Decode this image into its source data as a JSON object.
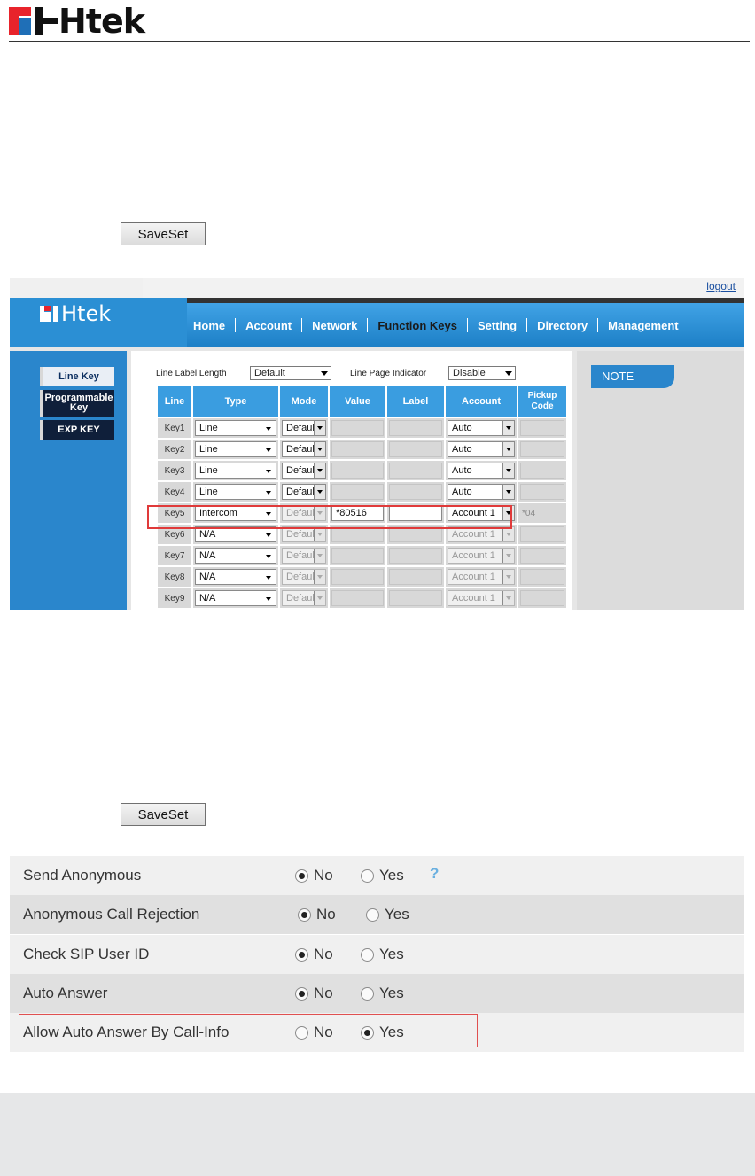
{
  "document": {
    "brand": "Htek"
  },
  "buttons": {
    "saveset_1": "SaveSet",
    "saveset_2": "SaveSet"
  },
  "webui": {
    "logout": "logout",
    "brand": "Htek",
    "nav": [
      {
        "label": "Home",
        "active": false
      },
      {
        "label": "Account",
        "active": false
      },
      {
        "label": "Network",
        "active": false
      },
      {
        "label": "Function Keys",
        "active": true
      },
      {
        "label": "Setting",
        "active": false
      },
      {
        "label": "Directory",
        "active": false
      },
      {
        "label": "Management",
        "active": false
      }
    ],
    "sidebar": [
      {
        "label": "Line Key",
        "active": true
      },
      {
        "label": "Programmable Key",
        "active": false
      },
      {
        "label": "EXP KEY",
        "active": false
      }
    ],
    "note_title": "NOTE",
    "line_label_length": {
      "label": "Line Label Length",
      "value": "Default"
    },
    "line_page_indicator": {
      "label": "Line Page Indicator",
      "value": "Disable"
    },
    "columns": [
      "Line",
      "Type",
      "Mode",
      "Value",
      "Label",
      "Account",
      "Pickup Code"
    ],
    "rows": [
      {
        "key": "Key1",
        "type": "Line",
        "mode": "Default",
        "value": "",
        "label": "",
        "account": "Auto",
        "pickup": "",
        "enabled": true,
        "editable": false
      },
      {
        "key": "Key2",
        "type": "Line",
        "mode": "Default",
        "value": "",
        "label": "",
        "account": "Auto",
        "pickup": "",
        "enabled": true,
        "editable": false
      },
      {
        "key": "Key3",
        "type": "Line",
        "mode": "Default",
        "value": "",
        "label": "",
        "account": "Auto",
        "pickup": "",
        "enabled": true,
        "editable": false
      },
      {
        "key": "Key4",
        "type": "Line",
        "mode": "Default",
        "value": "",
        "label": "",
        "account": "Auto",
        "pickup": "",
        "enabled": true,
        "editable": false
      },
      {
        "key": "Key5",
        "type": "Intercom",
        "mode": "Default",
        "value": "*80516",
        "label": "",
        "account": "Account 1",
        "pickup": "*04",
        "enabled": false,
        "editable": true
      },
      {
        "key": "Key6",
        "type": "N/A",
        "mode": "Default",
        "value": "",
        "label": "",
        "account": "Account 1",
        "pickup": "",
        "enabled": false,
        "editable": false
      },
      {
        "key": "Key7",
        "type": "N/A",
        "mode": "Default",
        "value": "",
        "label": "",
        "account": "Account 1",
        "pickup": "",
        "enabled": false,
        "editable": false
      },
      {
        "key": "Key8",
        "type": "N/A",
        "mode": "Default",
        "value": "",
        "label": "",
        "account": "Account 1",
        "pickup": "",
        "enabled": false,
        "editable": false
      },
      {
        "key": "Key9",
        "type": "N/A",
        "mode": "Default",
        "value": "",
        "label": "",
        "account": "Account 1",
        "pickup": "",
        "enabled": false,
        "editable": false
      }
    ]
  },
  "settings": {
    "no_label": "No",
    "yes_label": "Yes",
    "rows": [
      {
        "label": "Send Anonymous",
        "value": "No",
        "help": true
      },
      {
        "label": "Anonymous Call Rejection",
        "value": "No",
        "help": false
      },
      {
        "label": "Check SIP User ID",
        "value": "No",
        "help": false
      },
      {
        "label": "Auto Answer",
        "value": "No",
        "help": false
      },
      {
        "label": "Allow Auto Answer By Call-Info",
        "value": "Yes",
        "help": false
      }
    ]
  },
  "colors": {
    "brand_red": "#e8232b",
    "brand_blue": "#1f6fb7",
    "nav_blue": "#2a86cc",
    "highlight": "#e03a3a"
  }
}
